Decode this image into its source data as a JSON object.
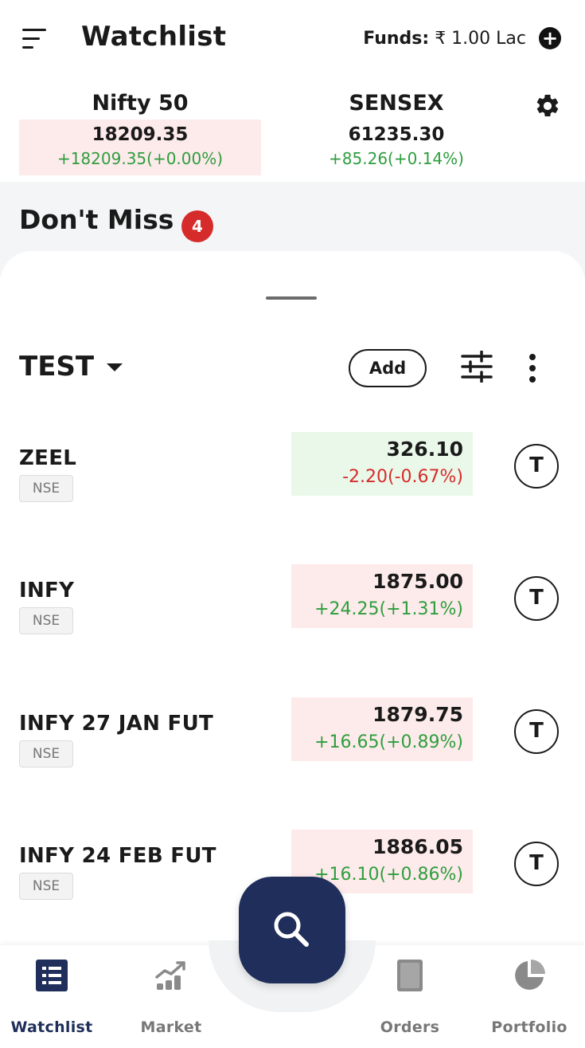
{
  "header": {
    "title": "Watchlist",
    "funds_label": "Funds:",
    "funds_value": "₹ 1.00 Lac"
  },
  "indices": [
    {
      "name": "Nifty 50",
      "value": "18209.35",
      "change": "+18209.35(+0.00%)",
      "bg": "#fdeaea"
    },
    {
      "name": "SENSEX",
      "value": "61235.30",
      "change": "+85.26(+0.14%)",
      "bg": "#ffffff"
    }
  ],
  "dont_miss": {
    "title": "Don't Miss",
    "badge": "4"
  },
  "watchlist": {
    "name": "TEST",
    "add_label": "Add",
    "rows": [
      {
        "symbol": "ZEEL",
        "exchange": "NSE",
        "price": "326.10",
        "change": "-2.20(-0.67%)",
        "change_color": "#d62b2b",
        "bg": "#eaf8ea",
        "trade": "T"
      },
      {
        "symbol": "INFY",
        "exchange": "NSE",
        "price": "1875.00",
        "change": "+24.25(+1.31%)",
        "change_color": "#2e9e3e",
        "bg": "#fdeaea",
        "trade": "T"
      },
      {
        "symbol": "INFY 27 JAN FUT",
        "exchange": "NSE",
        "price": "1879.75",
        "change": "+16.65(+0.89%)",
        "change_color": "#2e9e3e",
        "bg": "#fdeaea",
        "trade": "T"
      },
      {
        "symbol": "INFY 24 FEB FUT",
        "exchange": "NSE",
        "price": "1886.05",
        "change": "+16.10(+0.86%)",
        "change_color": "#2e9e3e",
        "bg": "#fdeaea",
        "trade": "T"
      }
    ]
  },
  "bottom_nav": {
    "items": [
      {
        "label": "Watchlist",
        "icon": "watchlist-icon",
        "active": true
      },
      {
        "label": "Market",
        "icon": "market-icon",
        "active": false
      },
      {
        "label": "Orders",
        "icon": "orders-icon",
        "active": false
      },
      {
        "label": "Portfolio",
        "icon": "portfolio-icon",
        "active": false
      }
    ],
    "fab_icon": "search-icon"
  },
  "colors": {
    "accent": "#1f2e5a",
    "positive": "#2e9e3e",
    "negative": "#d62b2b",
    "badge": "#d62b2b"
  }
}
